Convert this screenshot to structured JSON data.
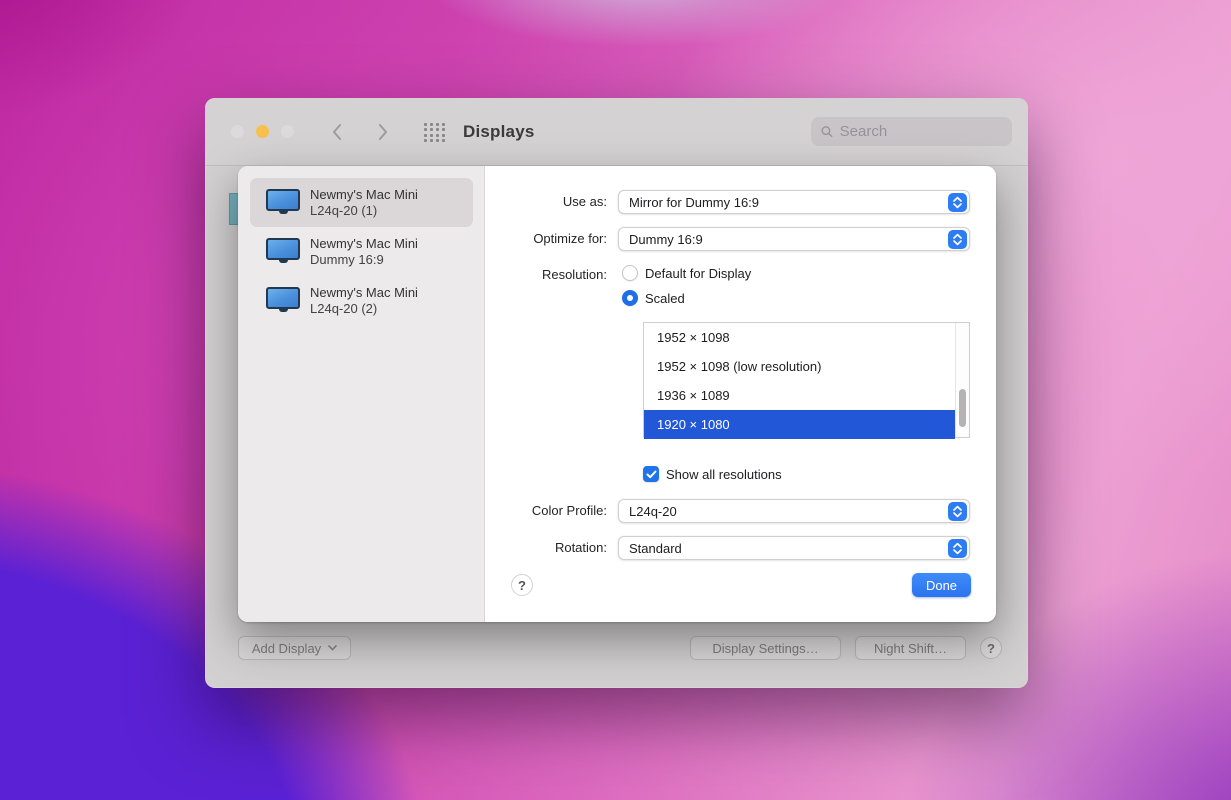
{
  "window": {
    "title": "Displays",
    "search_placeholder": "Search"
  },
  "sheet": {
    "sidebar": {
      "items": [
        {
          "name": "Newmy's Mac Mini",
          "detail": "L24q-20 (1)",
          "selected": true
        },
        {
          "name": "Newmy's Mac Mini",
          "detail": "Dummy 16:9",
          "selected": false
        },
        {
          "name": "Newmy's Mac Mini",
          "detail": "L24q-20 (2)",
          "selected": false
        }
      ]
    },
    "pane": {
      "use_as": {
        "label": "Use as:",
        "value": "Mirror for Dummy 16:9"
      },
      "optimize_for": {
        "label": "Optimize for:",
        "value": "Dummy 16:9"
      },
      "resolution": {
        "label": "Resolution:",
        "options": [
          {
            "label": "Default for Display",
            "selected": false
          },
          {
            "label": "Scaled",
            "selected": true
          }
        ]
      },
      "resolution_list": {
        "items": [
          "1952 × 1098",
          "1952 × 1098 (low resolution)",
          "1936 × 1089",
          "1920 × 1080"
        ],
        "selected_index": 3,
        "selected_value": "1920 × 1080"
      },
      "show_all_resolutions": {
        "label": "Show all resolutions",
        "checked": true
      },
      "color_profile": {
        "label": "Color Profile:",
        "value": "L24q-20"
      },
      "rotation": {
        "label": "Rotation:",
        "value": "Standard"
      },
      "help_label": "?",
      "done_label": "Done"
    }
  },
  "bottom_bar": {
    "add_display": "Add Display",
    "display_settings": "Display Settings…",
    "night_shift": "Night Shift…",
    "help_label": "?"
  },
  "colors": {
    "accent_blue": "#2e7cf3",
    "selection_blue": "#2257d8",
    "traffic_yellow": "#f6bf4e",
    "sidebar_bg": "#edeaeb",
    "window_gray": "#d3d0d1"
  }
}
